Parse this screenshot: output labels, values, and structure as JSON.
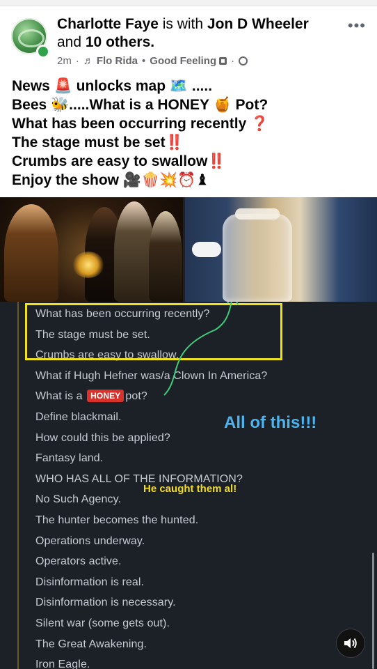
{
  "post": {
    "author": "Charlotte Faye",
    "with_word": " is with ",
    "tagged": "Jon D Wheeler",
    "and_word": " and ",
    "others": "10 others",
    "period": ".",
    "time": "2m",
    "music_note": "♬",
    "song_artist": "Flo Rida",
    "song_title": "Good Feeling",
    "more_label": "•••"
  },
  "post_text": {
    "line1": "News 🚨 unlocks map 🗺️ .....",
    "line2": "Bees 🐝.....What is a HONEY 🍯 Pot?",
    "line3": "What has been occurring recently ❓",
    "line4": "The stage must be set‼️",
    "line5": "Crumbs are easy to swallow‼️",
    "line6": "Enjoy the show 🎥🍿💥⏰♝"
  },
  "screenshot_text": {
    "lines": [
      "What has been occurring recently?",
      "The stage must be set.",
      "Crumbs are easy to swallow.",
      "What if Hugh Hefner was/a Clown In America?",
      "What is a ",
      "Define blackmail.",
      "How could this be applied?",
      "Fantasy land.",
      "WHO HAS ALL OF THE INFORMATION?",
      "No Such Agency.",
      "The hunter becomes the hunted.",
      "Operations underway.",
      "Operators active.",
      "Disinformation is real.",
      "Disinformation is necessary.",
      "Silent war (some gets out).",
      "The Great Awakening.",
      "Iron Eagle."
    ],
    "honey_badge": "HONEY",
    "pot_suffix": "pot?",
    "annotation_all": "All of this!!!",
    "annotation_caught": "He caught them al!"
  },
  "colors": {
    "highlight_box": "#f0e21a",
    "annotation_blue": "#4cb4ee",
    "annotation_yellow": "#f3dd23",
    "online_green": "#31a24c"
  },
  "icons": {
    "sound": "speaker-icon",
    "privacy": "globe-icon",
    "song": "music-note-icon"
  }
}
